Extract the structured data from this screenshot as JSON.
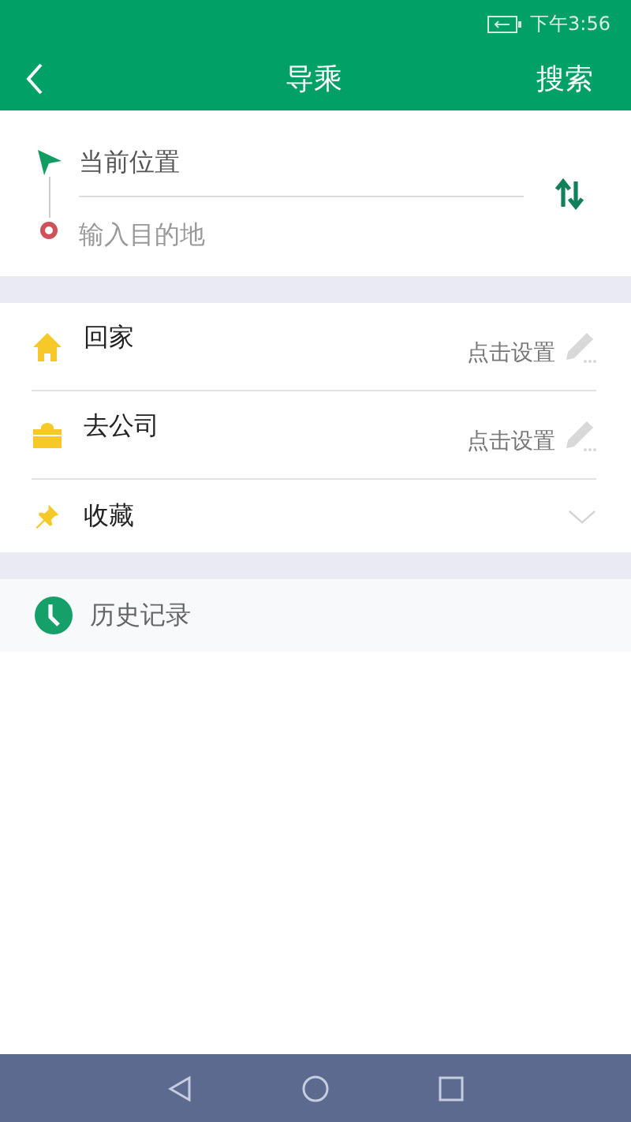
{
  "status_bar": {
    "time": "下午3:56"
  },
  "header": {
    "title": "导乘",
    "action": "搜索"
  },
  "route": {
    "origin": "当前位置",
    "destination_placeholder": "输入目的地"
  },
  "shortcuts": [
    {
      "kind": "home",
      "label": "回家",
      "hint": "点击设置"
    },
    {
      "kind": "work",
      "label": "去公司",
      "hint": "点击设置"
    },
    {
      "kind": "favorites",
      "label": "收藏",
      "expanded": false
    }
  ],
  "history": {
    "label": "历史记录"
  }
}
